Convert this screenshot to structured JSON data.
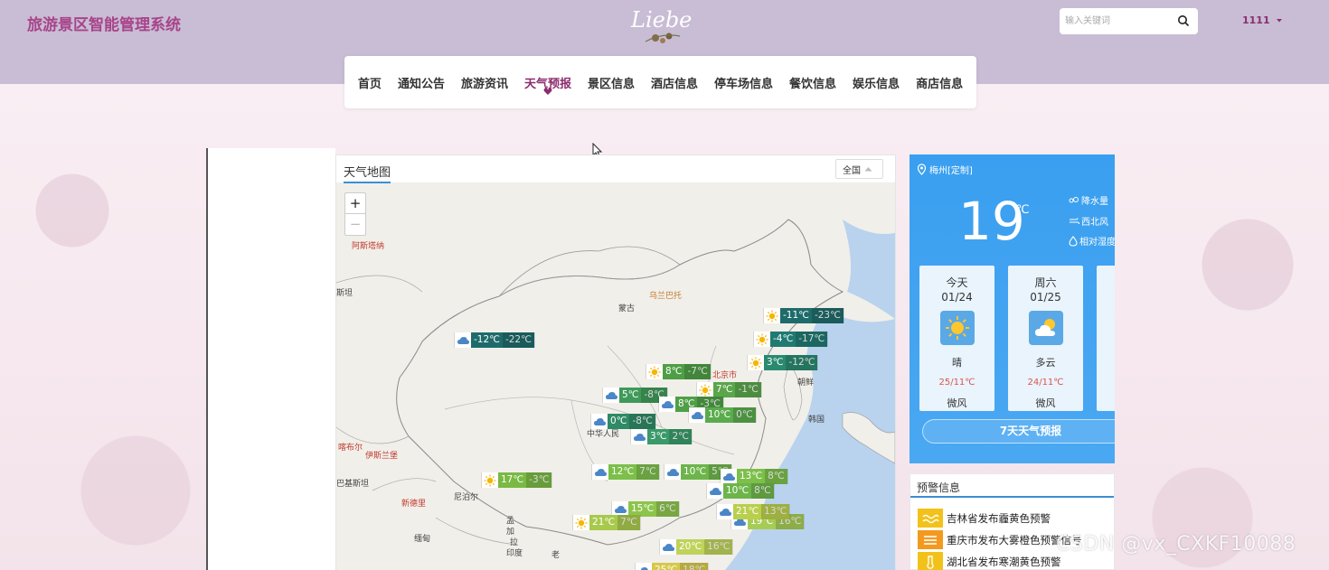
{
  "header": {
    "site_title": "旅游景区智能管理系统",
    "logo_text": "Liebe",
    "search_placeholder": "输入关键词",
    "user_name": "1111"
  },
  "nav": {
    "items": [
      {
        "label": "首页"
      },
      {
        "label": "通知公告"
      },
      {
        "label": "旅游资讯"
      },
      {
        "label": "天气预报",
        "active": true
      },
      {
        "label": "景区信息"
      },
      {
        "label": "酒店信息"
      },
      {
        "label": "停车场信息"
      },
      {
        "label": "餐饮信息"
      },
      {
        "label": "娱乐信息"
      },
      {
        "label": "商店信息"
      }
    ]
  },
  "map": {
    "title": "天气地图",
    "region_select": "全国",
    "zoom_in": "+",
    "zoom_out": "−",
    "place_labels": [
      {
        "text": "阿斯塔纳",
        "style": "red"
      },
      {
        "text": "斯坦",
        "style": "normal"
      },
      {
        "text": "乌兰巴托",
        "style": "orange"
      },
      {
        "text": "蒙古",
        "style": "normal"
      },
      {
        "text": "北京市",
        "style": "red"
      },
      {
        "text": "朝鲜",
        "style": "normal"
      },
      {
        "text": "韩国",
        "style": "normal"
      },
      {
        "text": "中华人民",
        "style": "normal"
      },
      {
        "text": "喀布尔",
        "style": "red"
      },
      {
        "text": "伊斯兰堡",
        "style": "red"
      },
      {
        "text": "巴基斯坦",
        "style": "normal"
      },
      {
        "text": "新德里",
        "style": "red"
      },
      {
        "text": "尼泊尔",
        "style": "normal"
      },
      {
        "text": "孟",
        "style": "normal"
      },
      {
        "text": "加",
        "style": "normal"
      },
      {
        "text": "拉",
        "style": "normal"
      },
      {
        "text": "印度",
        "style": "normal"
      },
      {
        "text": "缅甸",
        "style": "normal"
      },
      {
        "text": "老",
        "style": "normal"
      }
    ],
    "weather_labels": [
      {
        "icon": "sun-icon",
        "hi": "-11℃",
        "lo": "-23℃",
        "color": "#1f6b6b"
      },
      {
        "icon": "sun-icon",
        "hi": "-4℃",
        "lo": "-17℃",
        "color": "#1f7a72"
      },
      {
        "icon": "cloud-icon",
        "hi": "-12℃",
        "lo": "-22℃",
        "color": "#1f6b6b"
      },
      {
        "icon": "sun-icon",
        "hi": "3℃",
        "lo": "-12℃",
        "color": "#2a8a70"
      },
      {
        "icon": "sun-icon",
        "hi": "8℃",
        "lo": "-7℃",
        "color": "#4e9e45"
      },
      {
        "icon": "sun-icon",
        "hi": "7℃",
        "lo": "-1℃",
        "color": "#5aa64a"
      },
      {
        "icon": "cloud-icon",
        "hi": "5℃",
        "lo": "-8℃",
        "color": "#3f9a5a"
      },
      {
        "icon": "cloud-icon",
        "hi": "8℃",
        "lo": "-3℃",
        "color": "#4f9f47"
      },
      {
        "icon": "cloud-icon",
        "hi": "0℃",
        "lo": "-8℃",
        "color": "#2f8a66"
      },
      {
        "icon": "cloud-icon",
        "hi": "10℃",
        "lo": "0℃",
        "color": "#5aab4c"
      },
      {
        "icon": "cloud-icon",
        "hi": "3℃",
        "lo": "2℃",
        "color": "#3a9a6a"
      },
      {
        "icon": "sun-icon",
        "hi": "17℃",
        "lo": "-3℃",
        "color": "#79b944"
      },
      {
        "icon": "cloud-icon",
        "hi": "12℃",
        "lo": "7℃",
        "color": "#7cbf4a"
      },
      {
        "icon": "cloud-icon",
        "hi": "10℃",
        "lo": "5℃",
        "color": "#6db54b"
      },
      {
        "icon": "cloud-icon",
        "hi": "13℃",
        "lo": "8℃",
        "color": "#7cbf4a"
      },
      {
        "icon": "cloud-icon",
        "hi": "10℃",
        "lo": "8℃",
        "color": "#6db54b"
      },
      {
        "icon": "cloud-icon",
        "hi": "15℃",
        "lo": "6℃",
        "color": "#8dc54c"
      },
      {
        "icon": "sun-icon",
        "hi": "21℃",
        "lo": "7℃",
        "color": "#a8c94c"
      },
      {
        "icon": "cloud-icon",
        "hi": "19℃",
        "lo": "16℃",
        "color": "#a6cc55"
      },
      {
        "icon": "cloud-icon",
        "hi": "21℃",
        "lo": "13℃",
        "color": "#b9cf4d"
      },
      {
        "icon": "cloud-icon",
        "hi": "20℃",
        "lo": "16℃",
        "color": "#bfd35a"
      },
      {
        "icon": "cloud-icon",
        "hi": "25℃",
        "lo": "18℃",
        "color": "#d6c84a"
      }
    ]
  },
  "weather": {
    "location": "梅州[定制]",
    "current_temp": "19",
    "temp_unit": "℃",
    "side_info": [
      "降水量",
      "西北风",
      "相对湿度"
    ],
    "days": [
      {
        "name": "今天",
        "date": "01/24",
        "icon": "sun-icon",
        "cond": "晴",
        "range": "25/11℃",
        "wind": "微风"
      },
      {
        "name": "周六",
        "date": "01/25",
        "icon": "partly-cloudy-icon",
        "cond": "多云",
        "range": "24/11℃",
        "wind": "微风"
      }
    ],
    "forecast_button": "7天天气预报"
  },
  "alerts": {
    "title": "预警信息",
    "items": [
      {
        "text": "吉林省发布霾黄色预警",
        "color": "#f2c21a"
      },
      {
        "text": "重庆市发布大雾橙色预警信号",
        "color": "#f39a1e"
      },
      {
        "text": "湖北省发布寒潮黄色预警",
        "color": "#f2c21a"
      }
    ]
  },
  "watermark": "CSDN @vx_CXKF10088"
}
